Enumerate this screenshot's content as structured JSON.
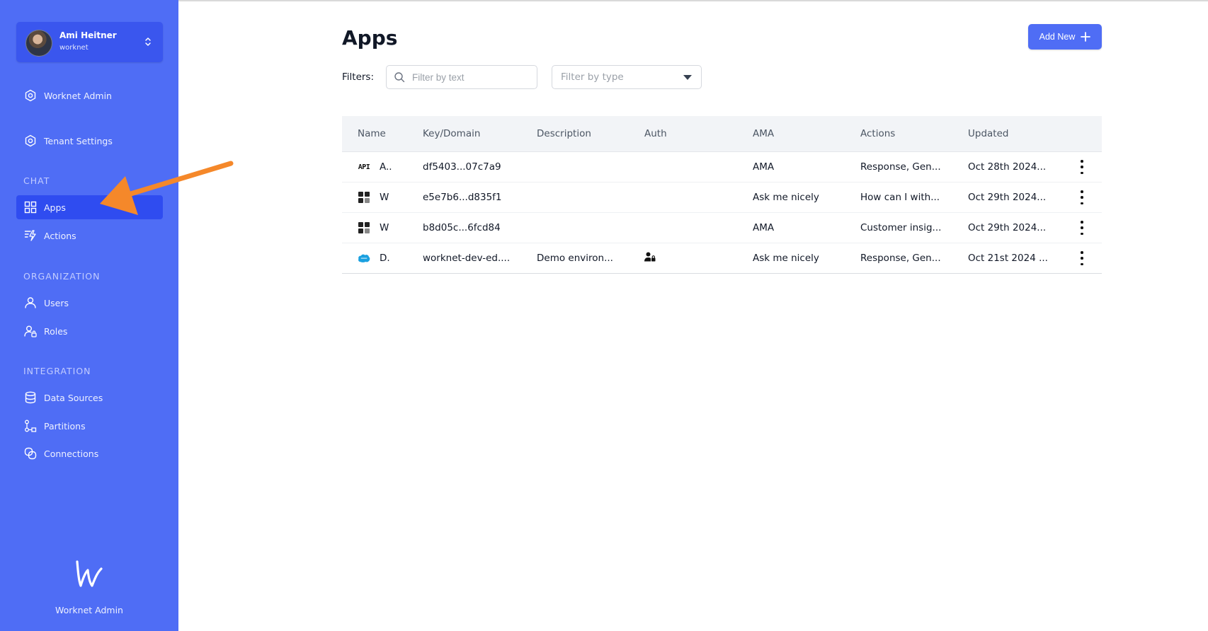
{
  "user": {
    "name": "Ami Heitner",
    "org": "worknet"
  },
  "sidebar": {
    "top_items": [
      {
        "label": "Worknet Admin",
        "icon": "hexagon-gear-icon"
      },
      {
        "label": "Tenant Settings",
        "icon": "hexagon-gear-icon"
      }
    ],
    "sections": [
      {
        "label": "CHAT",
        "items": [
          {
            "label": "Apps",
            "icon": "grid-icon",
            "active": true
          },
          {
            "label": "Actions",
            "icon": "actions-icon"
          }
        ]
      },
      {
        "label": "ORGANIZATION",
        "items": [
          {
            "label": "Users",
            "icon": "user-icon"
          },
          {
            "label": "Roles",
            "icon": "roles-icon"
          }
        ]
      },
      {
        "label": "INTEGRATION",
        "items": [
          {
            "label": "Data Sources",
            "icon": "database-icon"
          },
          {
            "label": "Partitions",
            "icon": "partitions-icon"
          },
          {
            "label": "Connections",
            "icon": "connections-icon"
          }
        ]
      }
    ],
    "brand": "Worknet Admin"
  },
  "main": {
    "title": "Apps",
    "add_button": "Add New",
    "filters_label": "Filters:",
    "filter_text_placeholder": "Filter by text",
    "filter_type_placeholder": "Filter by type"
  },
  "table": {
    "headers": [
      "Name",
      "Key/Domain",
      "Description",
      "Auth",
      "AMA",
      "Actions",
      "Updated"
    ],
    "rows": [
      {
        "icon": "api-icon",
        "icon_text": "API",
        "name": "A..",
        "key": "df5403...07c7a9",
        "description": "",
        "auth": "",
        "ama": "AMA",
        "actions": "Response, Gen...",
        "updated": "Oct 28th 2024..."
      },
      {
        "icon": "worknet-app-icon",
        "name": "W",
        "key": "e5e7b6...d835f1",
        "description": "",
        "auth": "",
        "ama": "Ask me nicely",
        "actions": "How can I with...",
        "updated": "Oct 29th 2024..."
      },
      {
        "icon": "worknet-app-icon",
        "name": "W",
        "key": "b8d05c...6fcd84",
        "description": "",
        "auth": "",
        "ama": "AMA",
        "actions": "Customer insig...",
        "updated": "Oct 29th 2024..."
      },
      {
        "icon": "salesforce-cloud-icon",
        "name": "D.",
        "key": "worknet-dev-ed....",
        "description": "Demo environ...",
        "auth": "user-lock-icon",
        "ama": "Ask me nicely",
        "actions": "Response, Gen...",
        "updated": "Oct 21st 2024 ..."
      }
    ]
  },
  "colors": {
    "sidebar": "#4f6df5",
    "active_item": "#2f4cf0",
    "accent": "#4f6df5",
    "annotation_arrow": "#f5882a"
  }
}
